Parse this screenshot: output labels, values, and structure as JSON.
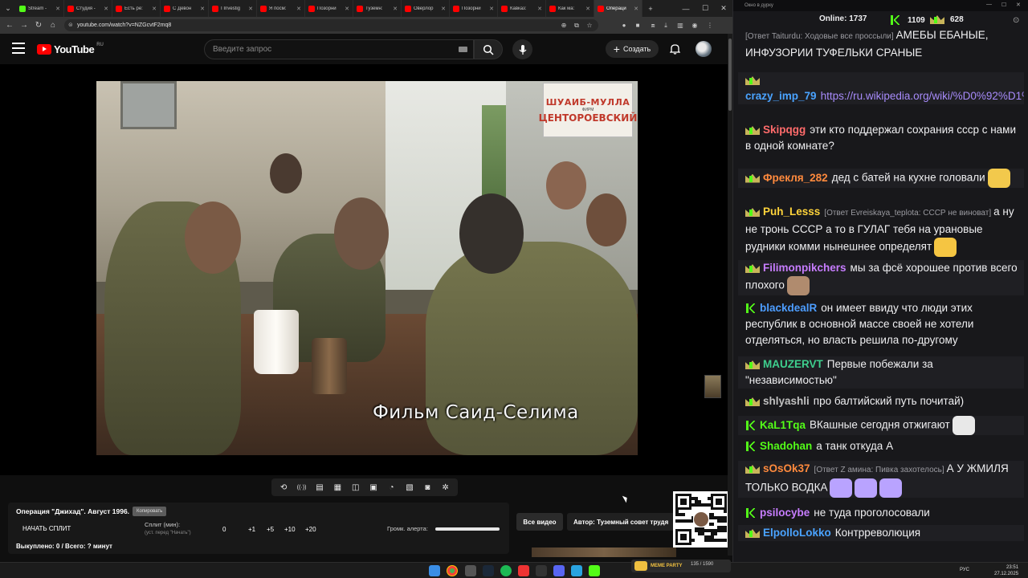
{
  "browser": {
    "tabs": [
      {
        "label": "Stream -",
        "color": "#53fc18"
      },
      {
        "label": "Студия -",
        "color": "#ff0000"
      },
      {
        "label": "Есть ре:",
        "color": "#ff0000"
      },
      {
        "label": "С Девон",
        "color": "#ff0000"
      },
      {
        "label": "I Investig",
        "color": "#ff0000"
      },
      {
        "label": "Я посм:",
        "color": "#ff0000"
      },
      {
        "label": "Позорни",
        "color": "#ff0000"
      },
      {
        "label": "Туземн:",
        "color": "#ff0000"
      },
      {
        "label": "Оверлор",
        "color": "#ff0000"
      },
      {
        "label": "Позорни",
        "color": "#ff0000"
      },
      {
        "label": "Кавказ:",
        "color": "#ff0000"
      },
      {
        "label": "Как ма:",
        "color": "#ff0000"
      },
      {
        "label": "Операци",
        "color": "#ff0000",
        "active": true
      }
    ],
    "new_tab": "+",
    "url": "youtube.com/watch?v=NZGcvtF2mq8"
  },
  "youtube": {
    "logo_text": "YouTube",
    "region": "RU",
    "search_placeholder": "Введите запрос",
    "create_label": "Создать"
  },
  "video": {
    "sign_line1": "ШУАИБ-МУЛЛА",
    "sign_line2": "ФИРМ",
    "sign_line3": "ЦЕНТОРОЕВСКИЙ",
    "caption": "Фильм  Саид-Селима"
  },
  "toolbar": {
    "icons": [
      "loop-icon",
      "cast-icon",
      "playlist-icon",
      "clapper-icon",
      "miniplayer-icon",
      "subtitles-icon",
      "speed-icon",
      "stats-icon",
      "screenshot-icon",
      "settings-icon"
    ]
  },
  "panel": {
    "title": "Операция \"Джихад\". Август 1996.",
    "tag": "Копировать",
    "start_split": "НАЧАТЬ СПЛИТ",
    "split_label": "Сплит (мин):",
    "split_hint": "(уст. перед \"Начать\")",
    "split_values": [
      "0",
      "+1",
      "+5",
      "+10",
      "+20"
    ],
    "alert_label": "Громк. алерта:",
    "alert_volume": 1.0,
    "bought": "Выкуплено: 0 / Всего: ? минут",
    "all_videos": "Все видео",
    "author": "Автор: Туземный совет трудя"
  },
  "chat": {
    "window_title": "Окно в дурку",
    "online_label": "Online: 1737",
    "stat_k": "1109",
    "stat_crown": "628",
    "messages": [
      {
        "user": "",
        "color": "#efeff1",
        "reply": "[Ответ Taiturdu: Ходовые все проссыли]",
        "text": "АМЕБЫ ЕБАНЫЕ, ИНФУЗОРИИ ТУФЕЛЬКИ СРАНЫЕ",
        "badge": "none"
      },
      {
        "user": "crazy_imp_79",
        "color": "#4aa3ff",
        "reply": "",
        "text": "https://ru.wikipedia.org/wiki/%D0%92%D1%81%D0%B5%D1%81%D0%BE...",
        "badge": "crown",
        "link": true
      },
      {
        "user": "Skipqgg",
        "color": "#ff6b6b",
        "reply": "",
        "text": "эти кто поддержал сохрания ссср с нами в одной комнате?",
        "badge": "crown"
      },
      {
        "user": "Фрекля_282",
        "color": "#ff8a3d",
        "reply": "",
        "text": "дед с батей на кухне головали",
        "badge": "crown",
        "emote": "#f2c94c"
      },
      {
        "user": "Puh_Lesss",
        "color": "#ffd43b",
        "reply": "[Ответ Evreiskaya_teplota: СССР не виноват]",
        "text": "а ну не тронь СССР а то в ГУЛАГ тебя на урановые рудники комми нынешнее определят",
        "badge": "crown",
        "emote": "#f5c542"
      },
      {
        "user": "Filimonpikchers",
        "color": "#c77dff",
        "reply": "",
        "text": "мы за фсё хорошее против всего плохого",
        "badge": "crown",
        "emote": "#b08b6e"
      },
      {
        "user": "blackdealR",
        "color": "#4d9dff",
        "reply": "",
        "text": "он имеет ввиду что люди этих республик в основной массе своей не хотели отделяться, но власть решила по-другому",
        "badge": "k"
      },
      {
        "user": "MAUZERVT",
        "color": "#3ecf8e",
        "reply": "",
        "text": "Первые побежали за \"независимостью\"",
        "badge": "crown"
      },
      {
        "user": "shlyashli",
        "color": "#c0c0c0",
        "reply": "",
        "text": "про балтийский путь почитай)",
        "badge": "crown"
      },
      {
        "user": "KaL1Tqa",
        "color": "#53fc18",
        "reply": "",
        "text": "ВКашные сегодня отжигают",
        "badge": "k",
        "emote": "#e8e8e8"
      },
      {
        "user": "Shadohan",
        "color": "#53fc18",
        "reply": "",
        "text": "а танк откуда А",
        "badge": "k"
      },
      {
        "user": "sOsOk37",
        "color": "#ff8a3d",
        "reply": "[Ответ Z амина: Пивка захотелось]",
        "text": "А У ЖМИЛЯ ТОЛЬКО ВОДКА",
        "badge": "crown",
        "emote": "#b9a3ff",
        "emote_count": 3
      },
      {
        "user": "psilocybe",
        "color": "#c77dff",
        "reply": "",
        "text": "не туда проголосовали",
        "badge": "k"
      },
      {
        "user": "ElpolloLokko",
        "color": "#4aa3ff",
        "reply": "",
        "text": "Контрреволюция",
        "badge": "crown"
      }
    ]
  },
  "taskbar": {
    "meme_label": "MEME PARTY",
    "meme_count": "135 / 1590",
    "tray_lang": "РУС",
    "time": "23:51",
    "date": "27.12.2025"
  }
}
